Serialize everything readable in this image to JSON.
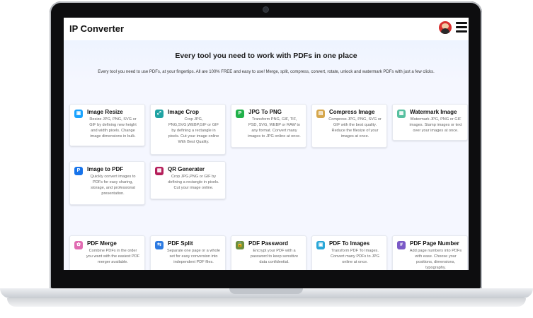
{
  "app": {
    "title": "IP Converter"
  },
  "hero": {
    "heading": "Every tool you need to work with PDFs in one place",
    "subheading": "Every tool you need to use PDFs, at your fingertips. All are 100% FREE and easy to use! Merge, split, compress, convert, rotate, unlock and watermark PDFs with just a few clicks."
  },
  "tools": [
    {
      "title": "Image Resize",
      "description": "Resize JPG, PNG, SVG or GIF by defining new height and width pixels. Change image dimensions in bulk.",
      "icon": "image-resize-icon",
      "color": "#1aa3ff"
    },
    {
      "title": "Image Crop",
      "description": "Crop JPG, PNG,SVG,WEBP,GIF or GIF by defining a rectangle in pixels. Cut your image online With Best Quality.",
      "icon": "image-crop-icon",
      "color": "#1fa3a3"
    },
    {
      "title": "JPG To PNG",
      "description": "Transform PNG, GIF, TIF, PSD, SVG, WEBP or RAW to any format. Convert many images to JPG online at once.",
      "icon": "jpg-to-png-icon",
      "color": "#21b14a"
    },
    {
      "title": "Compress Image",
      "description": "Compress JPG, PNG, SVG or GIF with the best quality. Reduce the filesize of your images at once.",
      "icon": "compress-image-icon",
      "color": "#d6a74d"
    },
    {
      "title": "Watermark Image",
      "description": "Watermark JPG, PNG or GIF images. Stamp images or text over your images at once.",
      "icon": "watermark-image-icon",
      "color": "#57c0a0"
    },
    {
      "title": "Image to PDF",
      "description": "Quickly convert images to PDFs for easy sharing, storage, and professional presentation.",
      "icon": "image-to-pdf-icon",
      "color": "#1773ea"
    },
    {
      "title": "QR Generater",
      "description": "Crop JPG,PNG or GIF by defining a rectangle in pixels. Cut your image online.",
      "icon": "qr-generator-icon",
      "color": "#b51f5b"
    },
    {
      "title": "PDF Merge",
      "description": "Combine PDFs in the order you want with the easiest PDF merger available.",
      "icon": "pdf-merge-icon",
      "color": "#e16bb2"
    },
    {
      "title": "PDF Split",
      "description": "Separate one page or a whole set for easy conversion into independent PDF files.",
      "icon": "pdf-split-icon",
      "color": "#2d7be2"
    },
    {
      "title": "PDF Password",
      "description": "Encrypt your PDF with a password to keep sensitive data confidential.",
      "icon": "pdf-password-icon",
      "color": "#6c8f3c"
    },
    {
      "title": "PDF To Images",
      "description": "Transform PDF To Images. Convert many PDFs to JPG online at once.",
      "icon": "pdf-to-images-icon",
      "color": "#2aa7d8"
    },
    {
      "title": "PDF Page Number",
      "description": "Add page numbers into PDFs with ease. Choose your positions, dimensions, typography.",
      "icon": "pdf-page-number-icon",
      "color": "#7b5ac7"
    }
  ]
}
